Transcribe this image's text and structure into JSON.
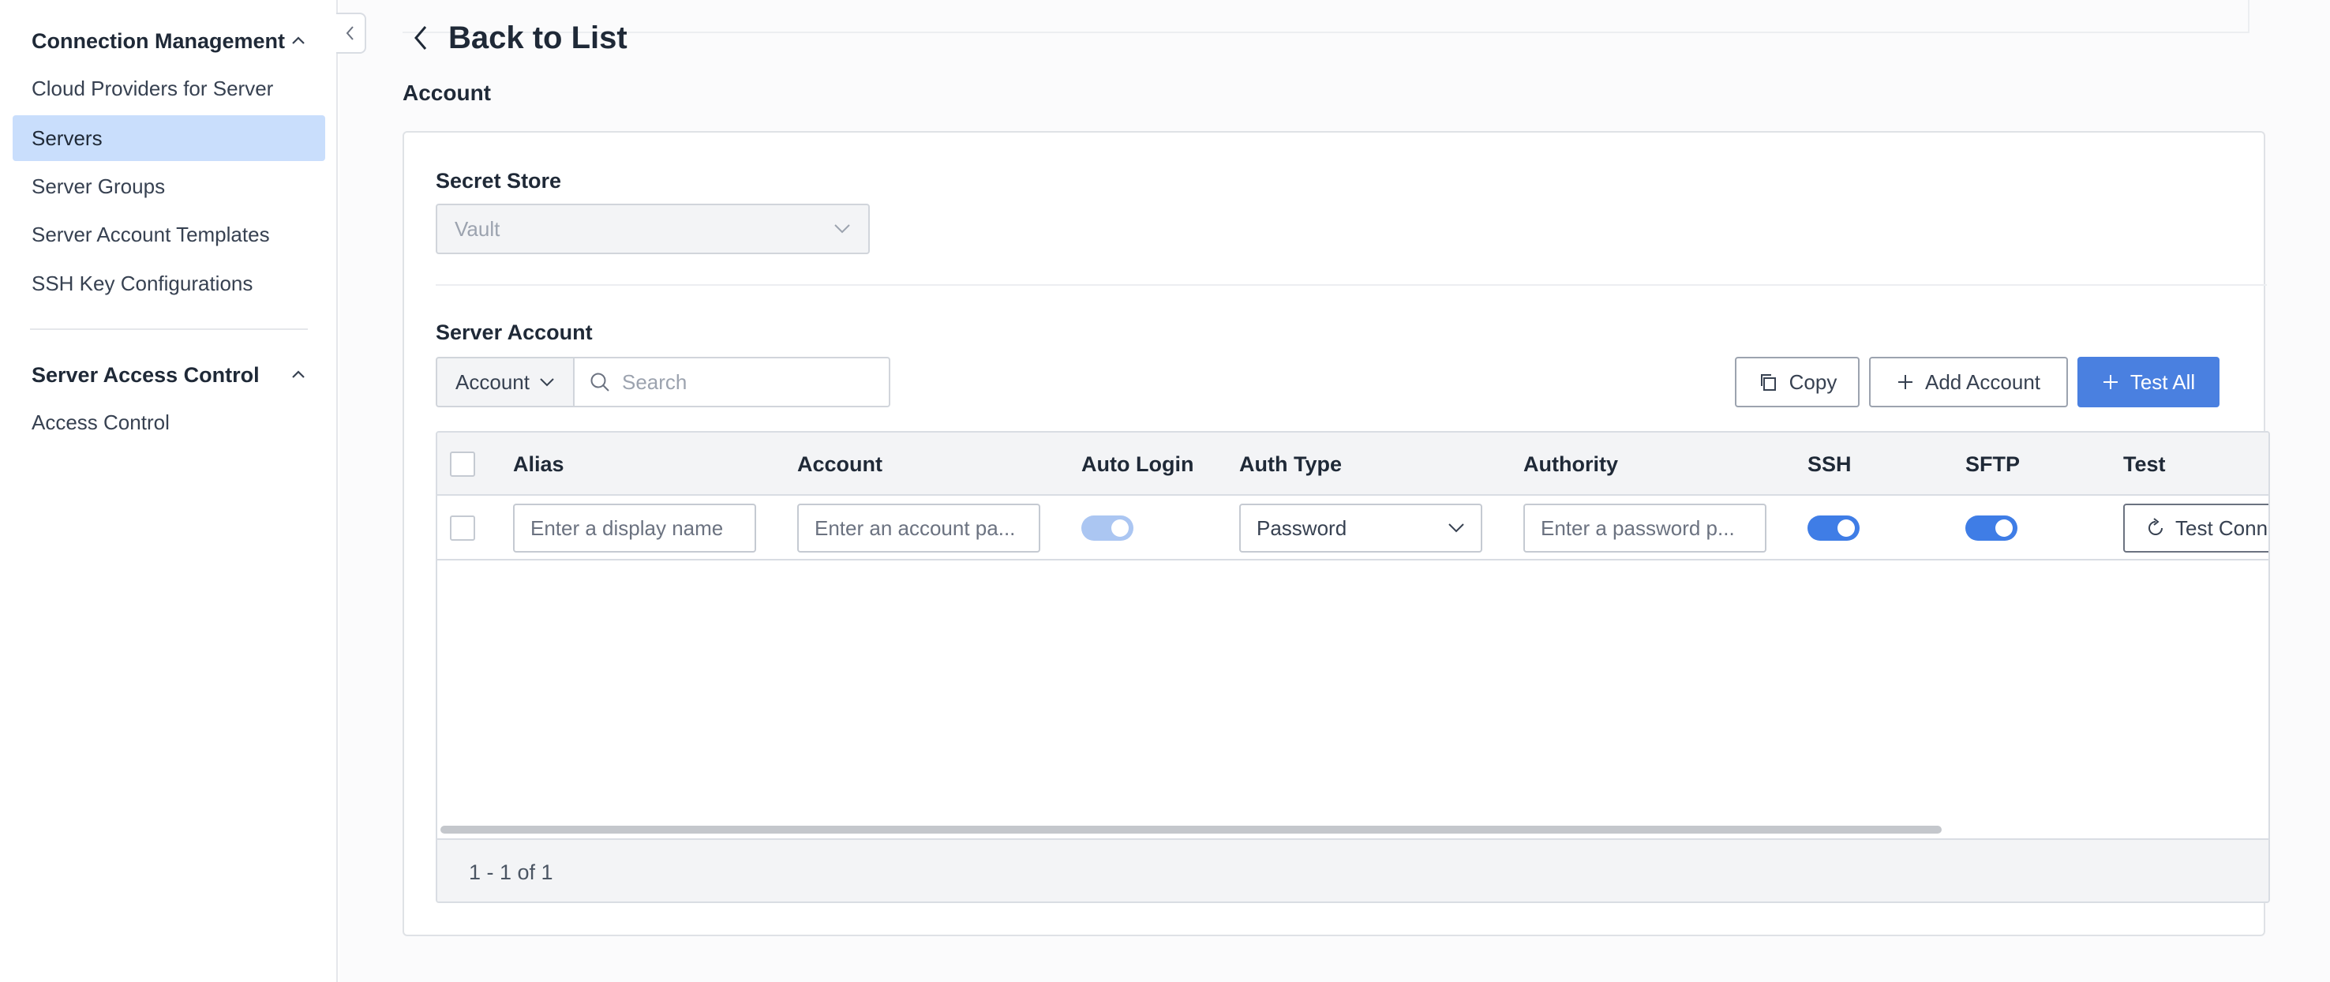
{
  "sidebar": {
    "groups": [
      {
        "title": "Connection Management",
        "items": [
          {
            "label": "Cloud Providers for Server",
            "active": false
          },
          {
            "label": "Servers",
            "active": true
          },
          {
            "label": "Server Groups",
            "active": false
          },
          {
            "label": "Server Account Templates",
            "active": false
          },
          {
            "label": "SSH Key Configurations",
            "active": false
          }
        ]
      },
      {
        "title": "Server Access Control",
        "items": [
          {
            "label": "Access Control",
            "active": false
          }
        ]
      }
    ]
  },
  "header": {
    "back_label": "Back to List",
    "section_title": "Account"
  },
  "secret_store": {
    "label": "Secret Store",
    "value": "Vault"
  },
  "server_account": {
    "label": "Server Account",
    "search_type": "Account",
    "search_placeholder": "Search",
    "buttons": {
      "copy": "Copy",
      "add_account": "Add Account",
      "test_all": "Test All"
    },
    "table": {
      "columns": [
        "Alias",
        "Account",
        "Auto Login",
        "Auth Type",
        "Authority",
        "SSH",
        "SFTP",
        "Test"
      ],
      "rows": [
        {
          "alias_placeholder": "Enter a display name",
          "account_placeholder": "Enter an account pa...",
          "auto_login": true,
          "auth_type": "Password",
          "authority_placeholder": "Enter a password p...",
          "ssh": true,
          "sftp": true,
          "test_label": "Test Conn"
        }
      ],
      "pagination": "1 - 1 of 1"
    }
  },
  "colors": {
    "primary": "#4a80e0",
    "active_nav": "#c9defc",
    "toggle_on": "#3f7de6",
    "toggle_disabled": "#abc6f2"
  }
}
